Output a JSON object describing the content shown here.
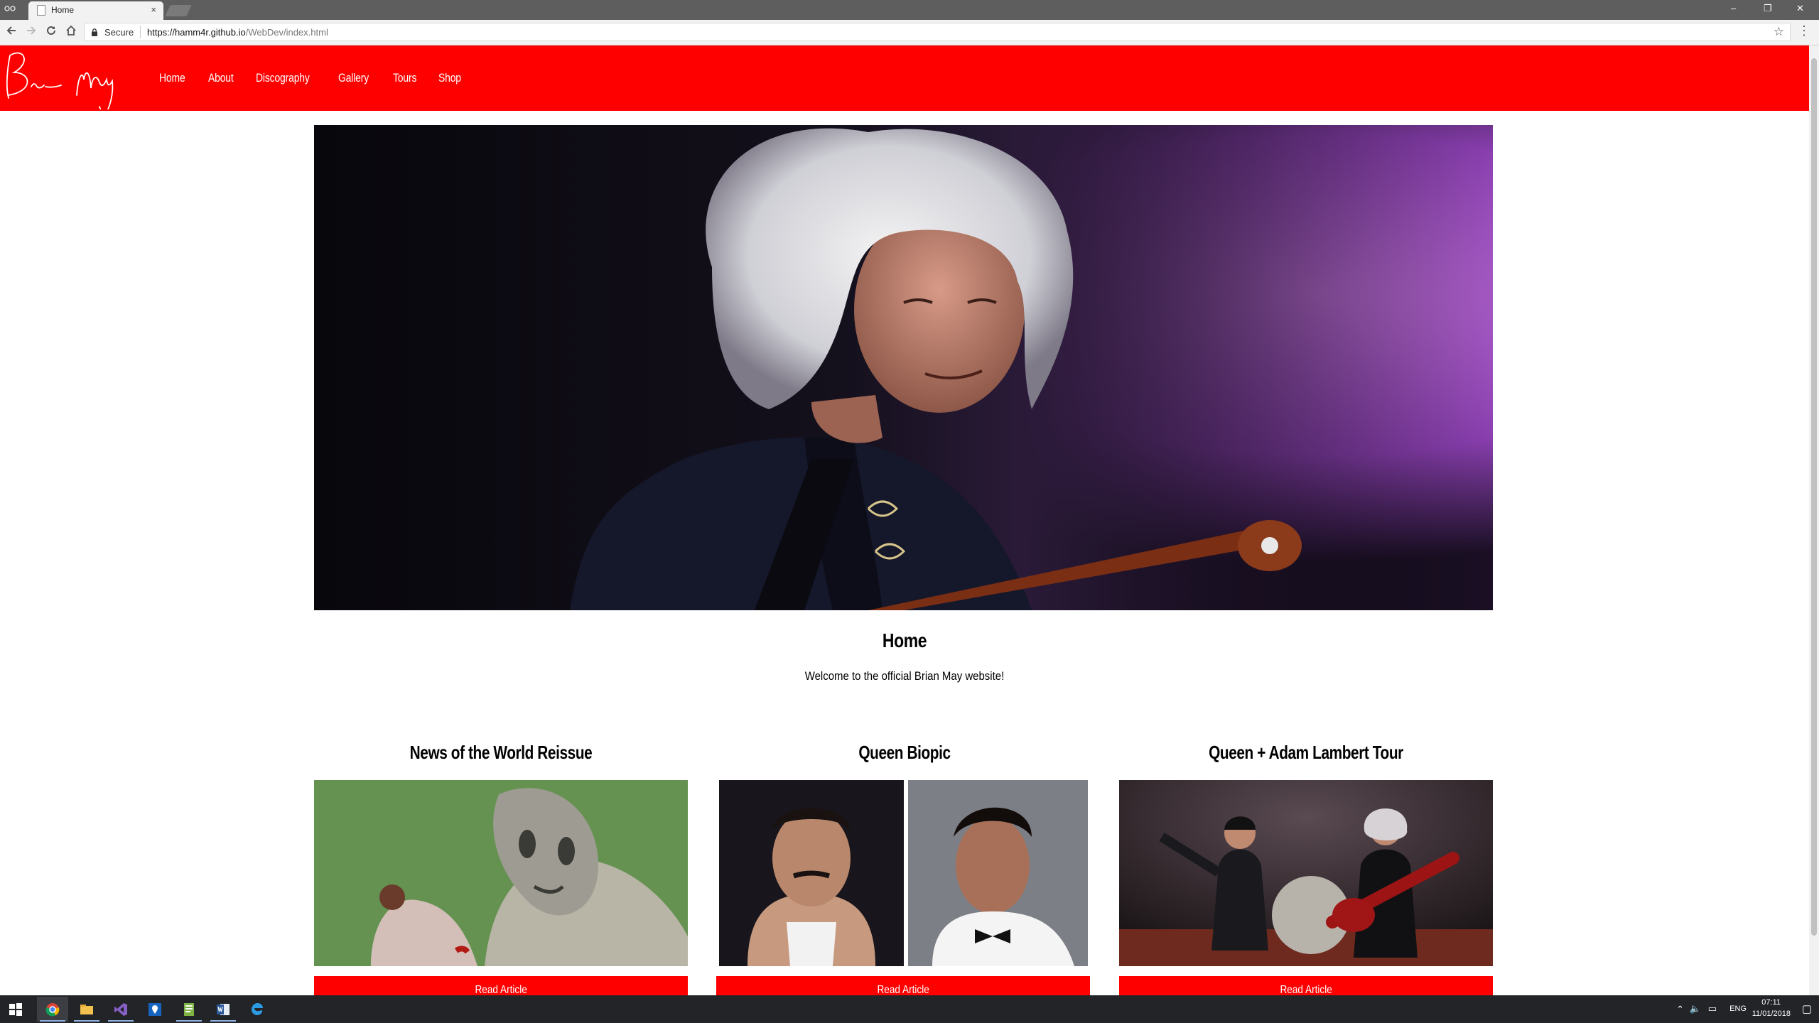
{
  "browser": {
    "tab_title": "Home",
    "tab_close": "×",
    "window_controls": {
      "minimize": "–",
      "restore": "❐",
      "close": "✕"
    },
    "security_label": "Secure",
    "url_host": "https://hamm4r.github.io",
    "url_path": "/WebDev/index.html",
    "icons": [
      "back-icon",
      "forward-icon",
      "reload-icon",
      "home-icon",
      "lock-icon",
      "star-icon",
      "menu-icon"
    ]
  },
  "site": {
    "nav": [
      "Home",
      "About",
      "Discography",
      "Gallery",
      "Tours",
      "Shop"
    ],
    "heading": "Home",
    "welcome": "Welcome to the official Brian May website!",
    "cards": [
      {
        "title": "News of the World Reissue",
        "button": "Read Article"
      },
      {
        "title": "Queen Biopic",
        "button": "Read Article"
      },
      {
        "title": "Queen + Adam Lambert Tour",
        "button": "Read Article"
      }
    ],
    "colors": {
      "accent": "#ff0000",
      "text": "#000000",
      "background": "#ffffff"
    }
  },
  "taskbar": {
    "apps": [
      "windows-start-icon",
      "chrome-icon",
      "file-explorer-icon",
      "visual-studio-icon",
      "maps-icon",
      "notepad-icon",
      "word-icon",
      "edge-icon"
    ],
    "language": "ENG",
    "time": "07:11",
    "date": "11/01/2018"
  }
}
